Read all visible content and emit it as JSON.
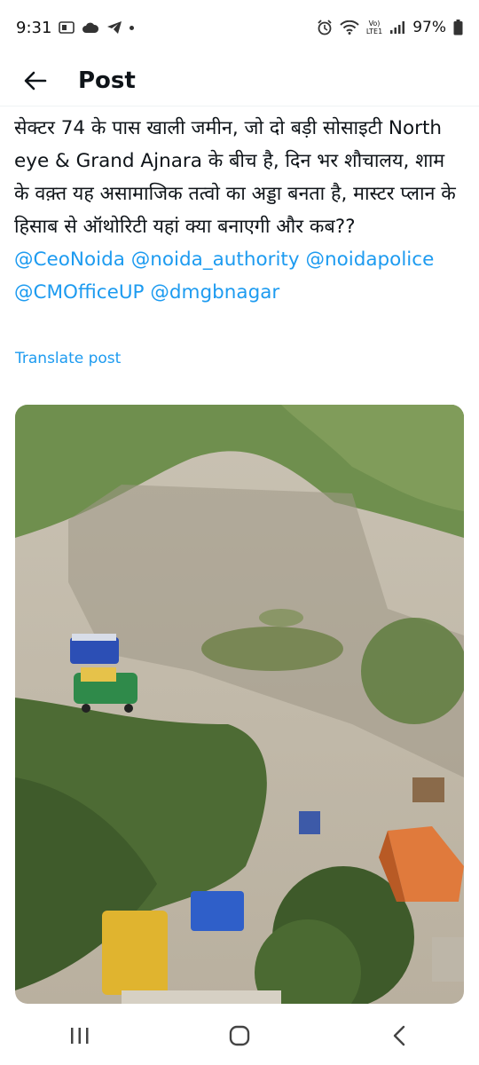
{
  "status_bar": {
    "time": "9:31",
    "battery_percent": "97%",
    "network_label_top": "Vo)",
    "network_label_bottom": "LTE1",
    "icons": [
      "sim-icon",
      "cloud-icon",
      "telegram-icon",
      "dot-icon",
      "alarm-icon",
      "wifi-icon",
      "signal-icon",
      "battery-icon"
    ]
  },
  "header": {
    "title": "Post"
  },
  "post": {
    "text_main": "सेक्टर 74 के पास खाली जमीन, जो दो बड़ी सोसाइटी North eye & Grand Ajnara के बीच है, दिन भर शौचालय, शाम के वक़्त यह असामाजिक तत्वो का अड्डा बनता है, मास्टर प्लान के हिसाब से ऑथोरिटी यहां क्या बनाएगी और कब?? ",
    "mentions": [
      "@CeoNoida",
      "@noida_authority",
      "@noidapolice",
      "@CMOfficeUP",
      "@dmgbnagar"
    ],
    "translate_label": "Translate post"
  },
  "colors": {
    "accent": "#1d9bf0",
    "text": "#0f1419"
  },
  "nav_bar": {
    "icons": [
      "recent-apps-icon",
      "home-icon",
      "back-icon"
    ]
  }
}
